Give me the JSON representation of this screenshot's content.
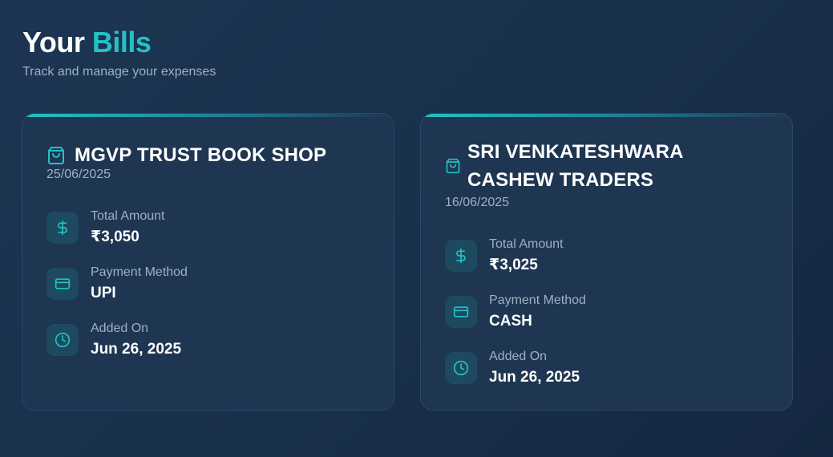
{
  "header": {
    "title_plain": "Your",
    "title_accent": "Bills",
    "subtitle": "Track and manage your expenses"
  },
  "colors": {
    "accent": "#22c2c8",
    "background": "#1b3350",
    "card": "#1e3651",
    "muted_text": "#9fb0c4"
  },
  "bills": [
    {
      "shop_name": "MGVP TRUST BOOK SHOP",
      "date": "25/06/2025",
      "total_label": "Total Amount",
      "total_value": "₹3,050",
      "payment_label": "Payment Method",
      "payment_value": "UPI",
      "added_label": "Added On",
      "added_value": "Jun 26, 2025"
    },
    {
      "shop_name_line1": "SRI VENKATESHWARA",
      "shop_name_line2": "CASHEW TRADERS",
      "date": "16/06/2025",
      "total_label": "Total Amount",
      "total_value": "₹3,025",
      "payment_label": "Payment Method",
      "payment_value": "CASH",
      "added_label": "Added On",
      "added_value": "Jun 26, 2025"
    }
  ],
  "icons": [
    "shopping-bag-icon",
    "dollar-icon",
    "credit-card-icon",
    "clock-icon"
  ]
}
